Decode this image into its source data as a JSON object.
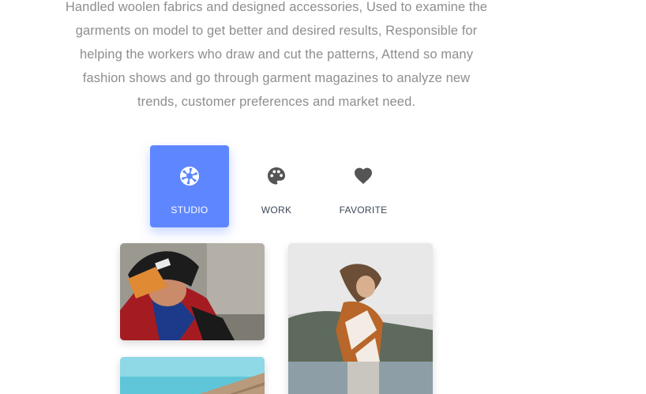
{
  "bio": {
    "lines": [
      "Handled woolen fabrics and designed accessories, Used to examine the",
      "garments on model to get better and desired results, Responsible for",
      "helping the workers who draw and cut the patterns, Attend so many",
      "fashion shows and go through garment magazines to analyze new",
      "trends, customer preferences and market need."
    ]
  },
  "tabs": [
    {
      "label": "STUDIO",
      "icon": "camera-shutter-icon",
      "active": true
    },
    {
      "label": "WORK",
      "icon": "palette-icon",
      "active": false
    },
    {
      "label": "FAVORITE",
      "icon": "heart-icon",
      "active": false
    }
  ],
  "gallery": {
    "images": [
      {
        "icon": "photo-man-in-cap"
      },
      {
        "icon": "photo-woman-by-lake"
      },
      {
        "icon": "photo-building-sky"
      }
    ]
  },
  "colors": {
    "accent": "#5e86ff",
    "body_text": "#8e8e8e",
    "tab_text": "#3c4858",
    "icon": "#555555"
  }
}
